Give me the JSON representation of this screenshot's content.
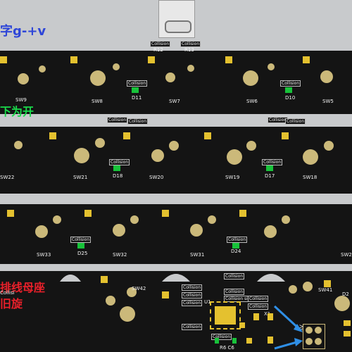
{
  "title_text": "字g-+v",
  "cn_labels": {
    "left1": "下为开",
    "left2": "排线母座",
    "left3": "旧旋"
  },
  "collision": "Collision",
  "collision_short": "Collisi",
  "collision_sion": "Collision sion",
  "r12": "R12",
  "r13": "R13",
  "row1": {
    "sw8": "SW8",
    "sw7": "SW7",
    "sw6": "SW6",
    "sw5": "SW5",
    "sw9": "SW9",
    "d11": "D11",
    "d10": "D10"
  },
  "row2": {
    "sw22": "SW22",
    "sw21": "SW21",
    "sw20": "SW20",
    "sw19": "SW19",
    "sw18": "SW18",
    "d18": "D18",
    "d17": "D17"
  },
  "row3": {
    "sw33": "SW33",
    "sw32": "SW32",
    "sw31": "SW31",
    "sw2": "SW2",
    "d25": "D25",
    "d24": "D24"
  },
  "row4": {
    "sw42": "SW42",
    "sw41": "SW41",
    "u1": "U1",
    "x1": "X1",
    "r6c6": "R6 C6",
    "d2": "D2",
    "sv": "SV"
  },
  "colors": {
    "board": "#141414",
    "pad": "#cbb97a",
    "square": "#e4c12f",
    "green": "#18c23a",
    "title": "#2e46d8",
    "green_text": "#19d94a",
    "red_text": "#e8202a"
  }
}
